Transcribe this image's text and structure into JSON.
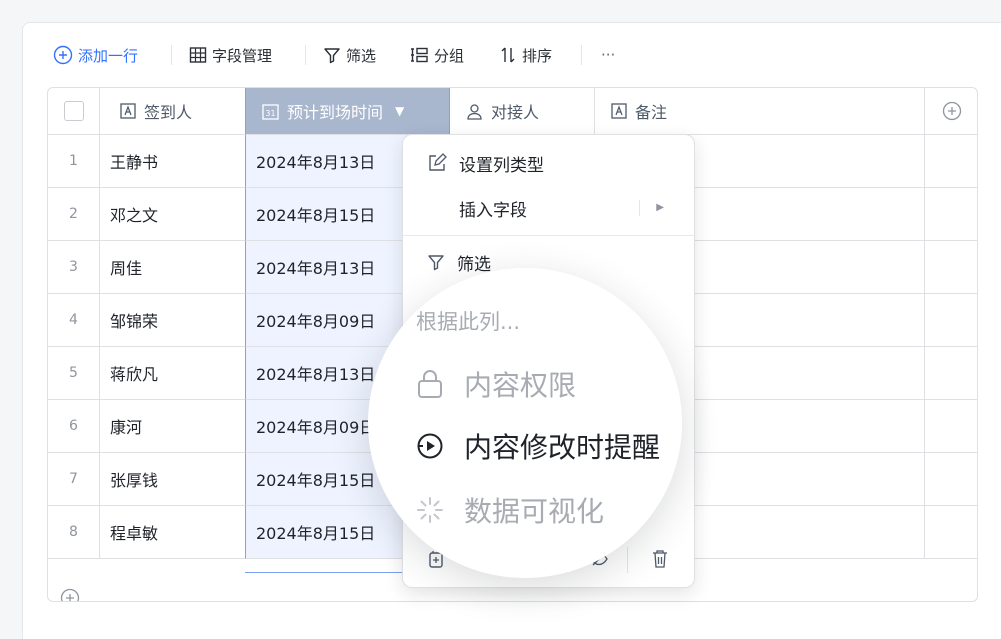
{
  "toolbar": {
    "add_row": "添加一行",
    "field_mgmt": "字段管理",
    "filter": "筛选",
    "group": "分组",
    "sort": "排序",
    "more": "···"
  },
  "columns": [
    {
      "label": "签到人",
      "icon": "text-type-icon"
    },
    {
      "label": "预计到场时间",
      "icon": "calendar-31-icon",
      "selected": true,
      "dropdown": "▼"
    },
    {
      "label": "对接人",
      "icon": "person-icon"
    },
    {
      "label": "备注",
      "icon": "text-type-icon"
    }
  ],
  "rows": [
    {
      "num": "1",
      "name": "王静书",
      "date": "2024年8月13日"
    },
    {
      "num": "2",
      "name": "邓之文",
      "date": "2024年8月15日"
    },
    {
      "num": "3",
      "name": "周佳",
      "date": "2024年8月13日"
    },
    {
      "num": "4",
      "name": "邹锦荣",
      "date": "2024年8月09日"
    },
    {
      "num": "5",
      "name": "蒋欣凡",
      "date": "2024年8月13日"
    },
    {
      "num": "6",
      "name": "康河",
      "date": "2024年8月09日"
    },
    {
      "num": "7",
      "name": "张厚钱",
      "date": "2024年8月15日"
    },
    {
      "num": "8",
      "name": "程卓敏",
      "date": "2024年8月15日"
    }
  ],
  "menu": {
    "set_column_type": "设置列类型",
    "insert_field": "插入字段",
    "insert_arrow": "▶",
    "filter": "筛选"
  },
  "magnifier": {
    "hint": "根据此列...",
    "permissions": "内容权限",
    "change_reminder": "内容修改时提醒",
    "visualize": "数据可视化"
  },
  "colors": {
    "accent": "#3370ff",
    "selected_header": "#a8b6ce",
    "selected_column": "#eef3ff"
  }
}
